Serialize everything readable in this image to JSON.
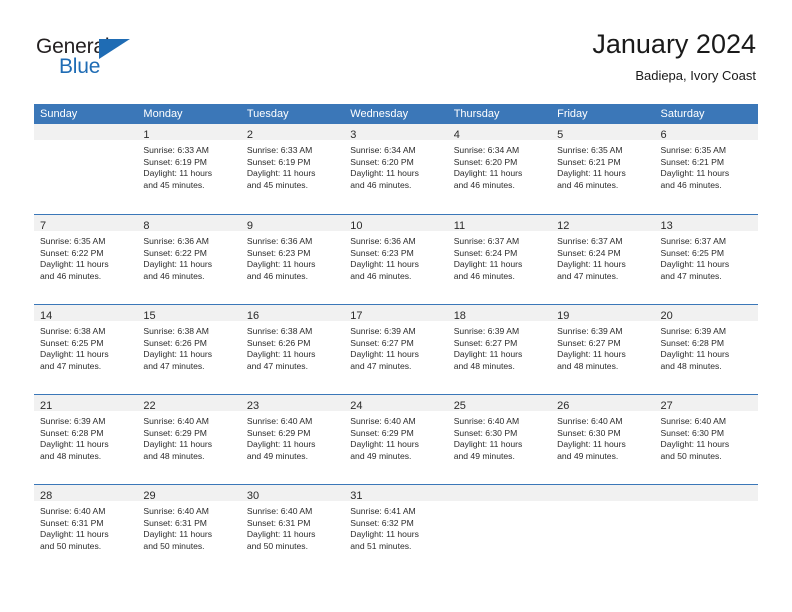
{
  "brand": {
    "name_part1": "General",
    "name_part2": "Blue"
  },
  "header": {
    "title": "January 2024",
    "subtitle": "Badiepa, Ivory Coast"
  },
  "colors": {
    "header_blue": "#3b77b8",
    "brand_blue": "#1f6cb4",
    "day_band_gray": "#f1f1f1",
    "text": "#2b2b2b"
  },
  "weekdays": [
    "Sunday",
    "Monday",
    "Tuesday",
    "Wednesday",
    "Thursday",
    "Friday",
    "Saturday"
  ],
  "weeks": [
    [
      {
        "day": "",
        "empty": true
      },
      {
        "day": "1",
        "sunrise": "Sunrise: 6:33 AM",
        "sunset": "Sunset: 6:19 PM",
        "daylight1": "Daylight: 11 hours",
        "daylight2": "and 45 minutes."
      },
      {
        "day": "2",
        "sunrise": "Sunrise: 6:33 AM",
        "sunset": "Sunset: 6:19 PM",
        "daylight1": "Daylight: 11 hours",
        "daylight2": "and 45 minutes."
      },
      {
        "day": "3",
        "sunrise": "Sunrise: 6:34 AM",
        "sunset": "Sunset: 6:20 PM",
        "daylight1": "Daylight: 11 hours",
        "daylight2": "and 46 minutes."
      },
      {
        "day": "4",
        "sunrise": "Sunrise: 6:34 AM",
        "sunset": "Sunset: 6:20 PM",
        "daylight1": "Daylight: 11 hours",
        "daylight2": "and 46 minutes."
      },
      {
        "day": "5",
        "sunrise": "Sunrise: 6:35 AM",
        "sunset": "Sunset: 6:21 PM",
        "daylight1": "Daylight: 11 hours",
        "daylight2": "and 46 minutes."
      },
      {
        "day": "6",
        "sunrise": "Sunrise: 6:35 AM",
        "sunset": "Sunset: 6:21 PM",
        "daylight1": "Daylight: 11 hours",
        "daylight2": "and 46 minutes."
      }
    ],
    [
      {
        "day": "7",
        "sunrise": "Sunrise: 6:35 AM",
        "sunset": "Sunset: 6:22 PM",
        "daylight1": "Daylight: 11 hours",
        "daylight2": "and 46 minutes."
      },
      {
        "day": "8",
        "sunrise": "Sunrise: 6:36 AM",
        "sunset": "Sunset: 6:22 PM",
        "daylight1": "Daylight: 11 hours",
        "daylight2": "and 46 minutes."
      },
      {
        "day": "9",
        "sunrise": "Sunrise: 6:36 AM",
        "sunset": "Sunset: 6:23 PM",
        "daylight1": "Daylight: 11 hours",
        "daylight2": "and 46 minutes."
      },
      {
        "day": "10",
        "sunrise": "Sunrise: 6:36 AM",
        "sunset": "Sunset: 6:23 PM",
        "daylight1": "Daylight: 11 hours",
        "daylight2": "and 46 minutes."
      },
      {
        "day": "11",
        "sunrise": "Sunrise: 6:37 AM",
        "sunset": "Sunset: 6:24 PM",
        "daylight1": "Daylight: 11 hours",
        "daylight2": "and 46 minutes."
      },
      {
        "day": "12",
        "sunrise": "Sunrise: 6:37 AM",
        "sunset": "Sunset: 6:24 PM",
        "daylight1": "Daylight: 11 hours",
        "daylight2": "and 47 minutes."
      },
      {
        "day": "13",
        "sunrise": "Sunrise: 6:37 AM",
        "sunset": "Sunset: 6:25 PM",
        "daylight1": "Daylight: 11 hours",
        "daylight2": "and 47 minutes."
      }
    ],
    [
      {
        "day": "14",
        "sunrise": "Sunrise: 6:38 AM",
        "sunset": "Sunset: 6:25 PM",
        "daylight1": "Daylight: 11 hours",
        "daylight2": "and 47 minutes."
      },
      {
        "day": "15",
        "sunrise": "Sunrise: 6:38 AM",
        "sunset": "Sunset: 6:26 PM",
        "daylight1": "Daylight: 11 hours",
        "daylight2": "and 47 minutes."
      },
      {
        "day": "16",
        "sunrise": "Sunrise: 6:38 AM",
        "sunset": "Sunset: 6:26 PM",
        "daylight1": "Daylight: 11 hours",
        "daylight2": "and 47 minutes."
      },
      {
        "day": "17",
        "sunrise": "Sunrise: 6:39 AM",
        "sunset": "Sunset: 6:27 PM",
        "daylight1": "Daylight: 11 hours",
        "daylight2": "and 47 minutes."
      },
      {
        "day": "18",
        "sunrise": "Sunrise: 6:39 AM",
        "sunset": "Sunset: 6:27 PM",
        "daylight1": "Daylight: 11 hours",
        "daylight2": "and 48 minutes."
      },
      {
        "day": "19",
        "sunrise": "Sunrise: 6:39 AM",
        "sunset": "Sunset: 6:27 PM",
        "daylight1": "Daylight: 11 hours",
        "daylight2": "and 48 minutes."
      },
      {
        "day": "20",
        "sunrise": "Sunrise: 6:39 AM",
        "sunset": "Sunset: 6:28 PM",
        "daylight1": "Daylight: 11 hours",
        "daylight2": "and 48 minutes."
      }
    ],
    [
      {
        "day": "21",
        "sunrise": "Sunrise: 6:39 AM",
        "sunset": "Sunset: 6:28 PM",
        "daylight1": "Daylight: 11 hours",
        "daylight2": "and 48 minutes."
      },
      {
        "day": "22",
        "sunrise": "Sunrise: 6:40 AM",
        "sunset": "Sunset: 6:29 PM",
        "daylight1": "Daylight: 11 hours",
        "daylight2": "and 48 minutes."
      },
      {
        "day": "23",
        "sunrise": "Sunrise: 6:40 AM",
        "sunset": "Sunset: 6:29 PM",
        "daylight1": "Daylight: 11 hours",
        "daylight2": "and 49 minutes."
      },
      {
        "day": "24",
        "sunrise": "Sunrise: 6:40 AM",
        "sunset": "Sunset: 6:29 PM",
        "daylight1": "Daylight: 11 hours",
        "daylight2": "and 49 minutes."
      },
      {
        "day": "25",
        "sunrise": "Sunrise: 6:40 AM",
        "sunset": "Sunset: 6:30 PM",
        "daylight1": "Daylight: 11 hours",
        "daylight2": "and 49 minutes."
      },
      {
        "day": "26",
        "sunrise": "Sunrise: 6:40 AM",
        "sunset": "Sunset: 6:30 PM",
        "daylight1": "Daylight: 11 hours",
        "daylight2": "and 49 minutes."
      },
      {
        "day": "27",
        "sunrise": "Sunrise: 6:40 AM",
        "sunset": "Sunset: 6:30 PM",
        "daylight1": "Daylight: 11 hours",
        "daylight2": "and 50 minutes."
      }
    ],
    [
      {
        "day": "28",
        "sunrise": "Sunrise: 6:40 AM",
        "sunset": "Sunset: 6:31 PM",
        "daylight1": "Daylight: 11 hours",
        "daylight2": "and 50 minutes."
      },
      {
        "day": "29",
        "sunrise": "Sunrise: 6:40 AM",
        "sunset": "Sunset: 6:31 PM",
        "daylight1": "Daylight: 11 hours",
        "daylight2": "and 50 minutes."
      },
      {
        "day": "30",
        "sunrise": "Sunrise: 6:40 AM",
        "sunset": "Sunset: 6:31 PM",
        "daylight1": "Daylight: 11 hours",
        "daylight2": "and 50 minutes."
      },
      {
        "day": "31",
        "sunrise": "Sunrise: 6:41 AM",
        "sunset": "Sunset: 6:32 PM",
        "daylight1": "Daylight: 11 hours",
        "daylight2": "and 51 minutes."
      },
      {
        "day": "",
        "empty": true
      },
      {
        "day": "",
        "empty": true
      },
      {
        "day": "",
        "empty": true
      }
    ]
  ]
}
